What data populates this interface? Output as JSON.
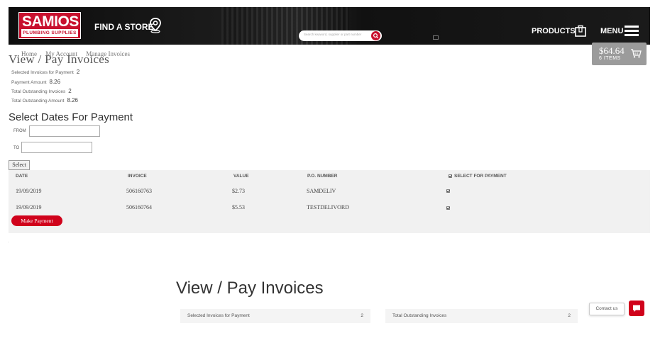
{
  "header": {
    "logo_main": "SAMIOS",
    "logo_sub": "PLUMBING SUPPLIES",
    "find_store": "FIND A STORE",
    "search_placeholder": "Search keyword, supplier or part number",
    "products": "PRODUCTS",
    "menu": "MENU"
  },
  "cart": {
    "amount": "$64.64",
    "items": "6 ITEMS"
  },
  "page": {
    "title": "View / Pay Invoices",
    "breadcrumb": [
      "Home",
      "My Account",
      "Manage Invoices"
    ]
  },
  "summary": [
    {
      "label": "Selected Invoices for Payment",
      "value": "2"
    },
    {
      "label": "Payment Amount",
      "value": "8.26"
    },
    {
      "label": "Total Outstanding Invoices",
      "value": "2"
    },
    {
      "label": "Total Outstanding Amount",
      "value": "8.26"
    }
  ],
  "dates": {
    "heading": "Select Dates For Payment",
    "from_label": "FROM",
    "to_label": "TO",
    "from_value": "",
    "to_value": "",
    "select_button": "Select"
  },
  "table": {
    "headers": [
      "DATE",
      "INVOICE",
      "VALUE",
      "P.O. NUMBER",
      "SELECT FOR PAYMENT"
    ],
    "rows": [
      {
        "date": "19/09/2019",
        "invoice": "506160763",
        "value": "$2.73",
        "po": "SAMDELIV",
        "selected": true
      },
      {
        "date": "19/09/2019",
        "invoice": "506160764",
        "value": "$5.53",
        "po": "TESTDELIVORD",
        "selected": true
      }
    ],
    "pay_button": "Make Payment"
  },
  "lower": {
    "title": "View / Pay Invoices",
    "boxes": [
      {
        "label": "Selected Invoices for Payment",
        "value": "2"
      },
      {
        "label": "Total Outstanding Invoices",
        "value": "2"
      }
    ]
  },
  "contact": {
    "label": "Contact us"
  },
  "colors": {
    "brand_red": "#d0021b",
    "header_bg": "#111111",
    "table_bg": "#f1f1f1"
  }
}
